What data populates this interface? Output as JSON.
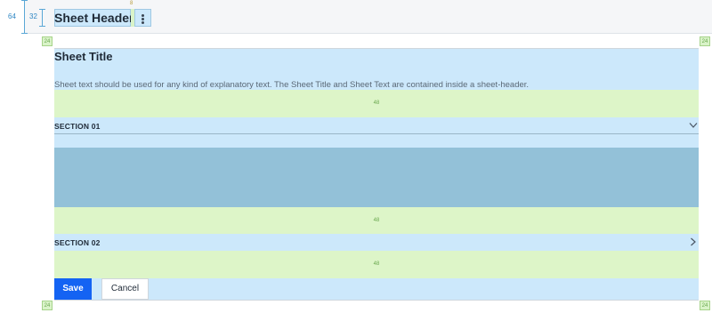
{
  "header": {
    "title": "Sheet Header",
    "height_label": "64",
    "inner_height_label": "32",
    "gap_label": "8"
  },
  "padding_labels": {
    "top_left": "24",
    "top_right": "24",
    "bottom_left": "24",
    "bottom_right": "24"
  },
  "sheet": {
    "title": "Sheet Title",
    "text": "Sheet text should be used for any kind of explanatory text. The Sheet Title and Sheet Text are contained inside a sheet-header."
  },
  "spacers": {
    "s1": "48",
    "s2": "48",
    "s3": "48"
  },
  "sections": [
    {
      "label": "SECTION 01",
      "state": "expanded",
      "icon": "chevron-down-icon"
    },
    {
      "label": "SECTION 02",
      "state": "collapsed",
      "icon": "chevron-right-icon"
    }
  ],
  "actions": {
    "save_label": "Save",
    "cancel_label": "Cancel"
  },
  "colors": {
    "spec_blue": "#cce8fb",
    "spec_green": "#ddf5c8",
    "content_block": "#93c1d8",
    "primary": "#1463f3"
  }
}
